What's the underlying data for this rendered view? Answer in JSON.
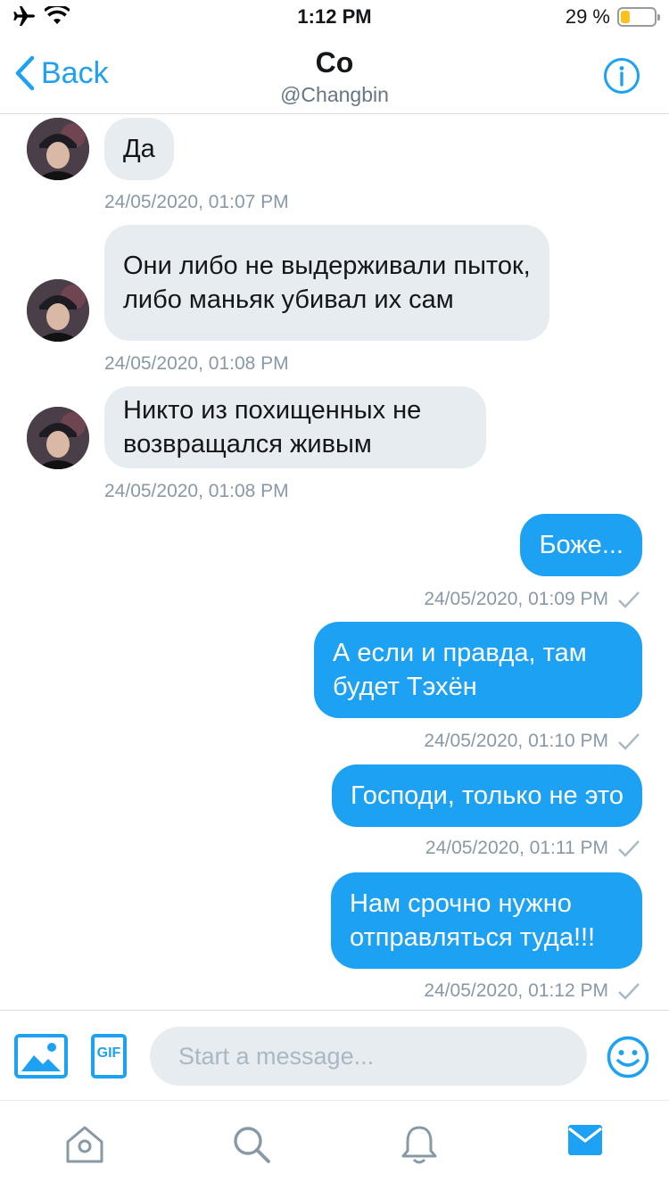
{
  "status_bar": {
    "time": "1:12 PM",
    "battery_percent_text": "29 %",
    "battery_level": 0.29,
    "battery_color": "#f7c31c",
    "icons": [
      "airplane-icon",
      "wifi-icon",
      "battery-icon"
    ]
  },
  "header": {
    "back_label": "Back",
    "title": "Co",
    "handle": "@Changbin",
    "accent": "#1da1f2"
  },
  "messages": [
    {
      "direction": "in",
      "text": "Да",
      "timestamp": "24/05/2020, 01:07 PM"
    },
    {
      "direction": "in",
      "text": "Они либо не выдерживали пыток, либо маньяк убивал их сам",
      "timestamp": "24/05/2020, 01:08 PM"
    },
    {
      "direction": "in",
      "text": "Никто из похищенных не возвращался живым",
      "timestamp": "24/05/2020, 01:08 PM"
    },
    {
      "direction": "out",
      "text": "Боже...",
      "timestamp": "24/05/2020, 01:09 PM"
    },
    {
      "direction": "out",
      "text": "А если и правда, там будет Тэхён",
      "timestamp": "24/05/2020, 01:10 PM"
    },
    {
      "direction": "out",
      "text": "Господи, только не это",
      "timestamp": "24/05/2020, 01:11 PM"
    },
    {
      "direction": "out",
      "text": "Нам срочно нужно отправляться туда!!!",
      "timestamp": "24/05/2020, 01:12 PM"
    }
  ],
  "composer": {
    "placeholder": "Start a message...",
    "gif_label": "GIF",
    "icons": [
      "image-icon",
      "gif-icon",
      "emoji-icon"
    ]
  },
  "tabbar": {
    "tabs": [
      "home-icon",
      "search-icon",
      "notifications-icon",
      "messages-icon"
    ],
    "active": "messages-icon"
  }
}
